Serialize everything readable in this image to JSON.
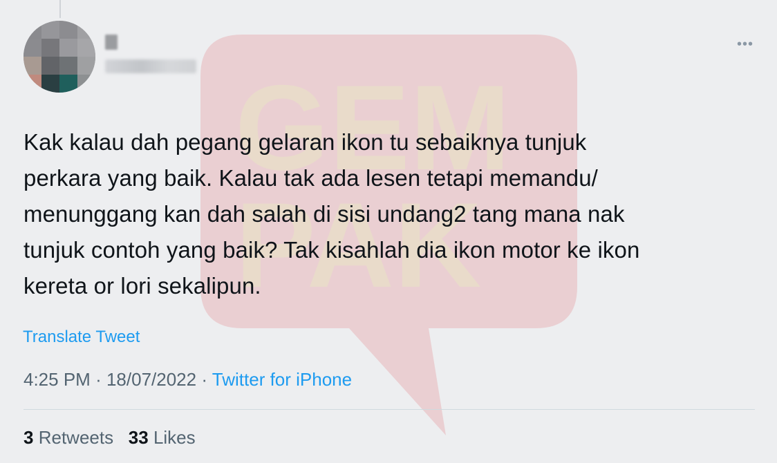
{
  "colors": {
    "background": "#edeef0",
    "text": "#0f1419",
    "secondary_text": "#536471",
    "link": "#1d9bf0",
    "divider": "#cfd9de",
    "watermark": "#e8b7b9"
  },
  "user": {
    "name": "",
    "handle": "@"
  },
  "icons": {
    "more": "more-options-icon"
  },
  "tweet": {
    "lines": [
      "Kak kalau dah pegang gelaran ikon tu sebaiknya tunjuk",
      "perkara yang baik. Kalau tak ada lesen tetapi memandu/",
      "menunggang kan dah salah di sisi undang2 tang mana nak",
      "tunjuk contoh yang baik? Tak kisahlah dia ikon motor ke ikon",
      "kereta or lori sekalipun."
    ],
    "translate_label": "Translate Tweet",
    "time": "4:25 PM",
    "separator": "·",
    "date": "18/07/2022",
    "source": "Twitter for iPhone"
  },
  "stats": {
    "retweets_count": "3",
    "retweets_label": "Retweets",
    "likes_count": "33",
    "likes_label": "Likes"
  },
  "watermark": {
    "text_line1": "GEM",
    "text_line2": "PAK"
  }
}
